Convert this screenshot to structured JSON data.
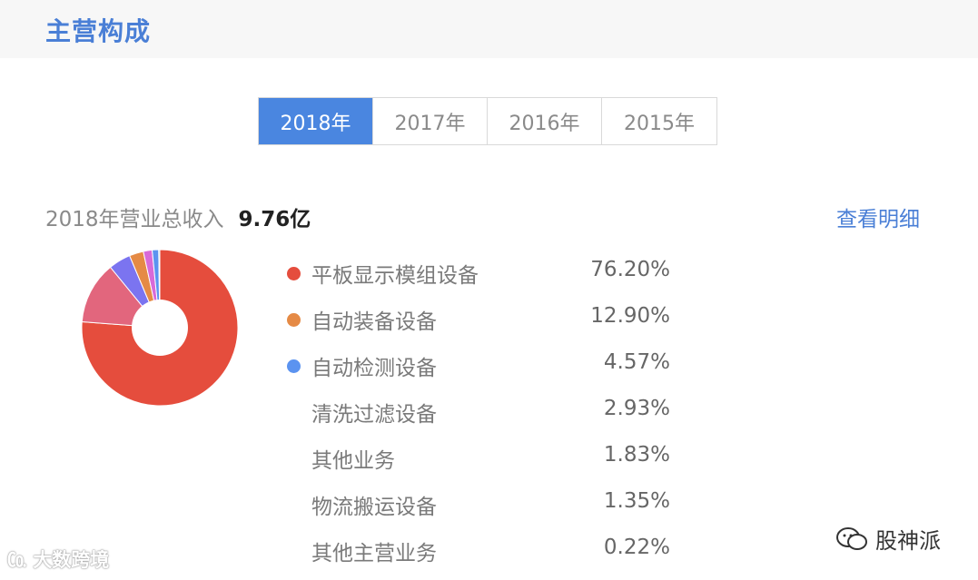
{
  "header": {
    "title": "主营构成"
  },
  "tabs": [
    {
      "label": "2018年",
      "active": true
    },
    {
      "label": "2017年",
      "active": false
    },
    {
      "label": "2016年",
      "active": false
    },
    {
      "label": "2015年",
      "active": false
    }
  ],
  "summary": {
    "label": "2018年营业总收入",
    "value": "9.76亿"
  },
  "detail_link": "查看明细",
  "segments": [
    {
      "name": "平板显示模组设备",
      "percent": "76.20%",
      "value": 76.2,
      "color": "#e54d3d",
      "show_dot": true
    },
    {
      "name": "自动装备设备",
      "percent": "12.90%",
      "value": 12.9,
      "color": "#e2667d",
      "dot_color": "#e58a45",
      "show_dot": true
    },
    {
      "name": "自动检测设备",
      "percent": "4.57%",
      "value": 4.57,
      "color": "#7b74f0",
      "dot_color": "#5b93f0",
      "show_dot": true
    },
    {
      "name": "清洗过滤设备",
      "percent": "2.93%",
      "value": 2.93,
      "color": "#e58a45",
      "show_dot": false
    },
    {
      "name": "其他业务",
      "percent": "1.83%",
      "value": 1.83,
      "color": "#d86ad8",
      "show_dot": false
    },
    {
      "name": "物流搬运设备",
      "percent": "1.35%",
      "value": 1.35,
      "color": "#5b93f0",
      "show_dot": false
    },
    {
      "name": "其他主营业务",
      "percent": "0.22%",
      "value": 0.22,
      "color": "#3fb8c9",
      "show_dot": false
    }
  ],
  "watermarks": {
    "left": "大数跨境",
    "right": "股神派"
  }
}
